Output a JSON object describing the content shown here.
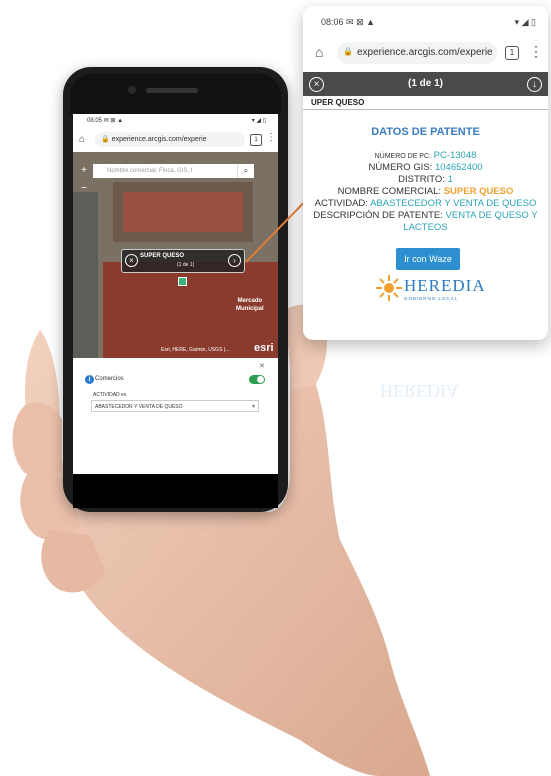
{
  "colors": {
    "accent": "#3a7ec2",
    "teal": "#2aa4b8",
    "orange": "#f0a030",
    "waze": "#2c8fcf",
    "arrow": "#e07b39"
  },
  "phone": {
    "status_time": "08:05",
    "status_icons_left": "✉ ⊠ ▲",
    "status_icons_right": "▾ ◢ ▯",
    "url": "experience.arcgis.com/experie",
    "home_icon": "home-icon",
    "search_placeholder": "Nombre comercial, Finca, GIS, I",
    "popup_name": "SUPER QUESO",
    "popup_count": "(1 de 1)",
    "map_label_1": "Mercado",
    "map_label_2": "Municipal",
    "attribution": "Esri, HERE, Garmin, USGS |...",
    "esri": "esri",
    "layer_name": "Comercios",
    "field_label": "ACTIVIDAD es",
    "field_value": "ABASTECEDOR Y VENTA DE QUESO"
  },
  "card": {
    "status_time": "08:06",
    "url": "experience.arcgis.com/experie",
    "count": "(1 de 1)",
    "feature_name": "UPER QUESO",
    "title": "DATOS DE PATENTE",
    "pc_label": "NÚMERO DE PC:",
    "pc_value": "PC-13048",
    "gis_label": "NÚMERO GIS:",
    "gis_value": "104652400",
    "distrito_label": "DISTRITO:",
    "distrito_value": "1",
    "nombre_label": "NOMBRE COMERCIAL:",
    "nombre_value": "SUPER QUESO",
    "actividad_label": "ACTIVIDAD:",
    "actividad_value": "ABASTECEDOR Y VENTA DE QUESO",
    "desc_label": "DESCRIPCIÓN DE PATENTE:",
    "desc_value": "VENTA DE QUESO Y LACTEOS",
    "waze_button": "Ir con Waze",
    "logo_text": "HEREDIA",
    "logo_sub": "GOBIERNO LOCAL"
  }
}
